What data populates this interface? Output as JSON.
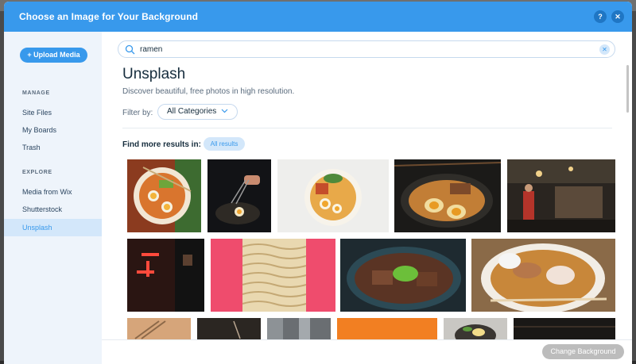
{
  "modal": {
    "title": "Choose an Image for Your Background",
    "help_label": "?",
    "close_label": "✕"
  },
  "sidebar": {
    "upload_label": "+ Upload Media",
    "sections": [
      {
        "title": "MANAGE",
        "items": [
          "Site Files",
          "My Boards",
          "Trash"
        ]
      },
      {
        "title": "EXPLORE",
        "items": [
          "Media from Wix",
          "Shutterstock",
          "Unsplash"
        ]
      }
    ],
    "active_item": "Unsplash"
  },
  "search": {
    "value": "ramen",
    "clear_label": "✕"
  },
  "main": {
    "title": "Unsplash",
    "subtitle": "Discover beautiful, free photos in high resolution.",
    "filter_label": "Filter by:",
    "filter_value": "All Categories",
    "more_label": "Find more results in:",
    "more_chip": "All results"
  },
  "footer": {
    "change_label": "Change Background"
  },
  "colors": {
    "accent": "#3899ec",
    "sidebar_bg": "#eef4fb",
    "active_item_bg": "#d3e7fa",
    "disabled_button": "#bcbcbc"
  },
  "images": [
    {
      "name": "ramen-bowl-top-view"
    },
    {
      "name": "chopsticks-noodles-dark"
    },
    {
      "name": "ramen-bowl-white-bg"
    },
    {
      "name": "ramen-eggs-dark-table"
    },
    {
      "name": "ramen-shop-kitchen"
    },
    {
      "name": "neon-sign-night"
    },
    {
      "name": "dry-noodles-pink-bg"
    },
    {
      "name": "beef-ramen-green-onion"
    },
    {
      "name": "ramen-spoon-chopsticks"
    },
    {
      "name": "wooden-chopsticks"
    },
    {
      "name": "dark-noodles"
    },
    {
      "name": "grey-cloth"
    },
    {
      "name": "orange-surface"
    },
    {
      "name": "ramen-bowl-egg"
    },
    {
      "name": "dark-wood"
    }
  ]
}
